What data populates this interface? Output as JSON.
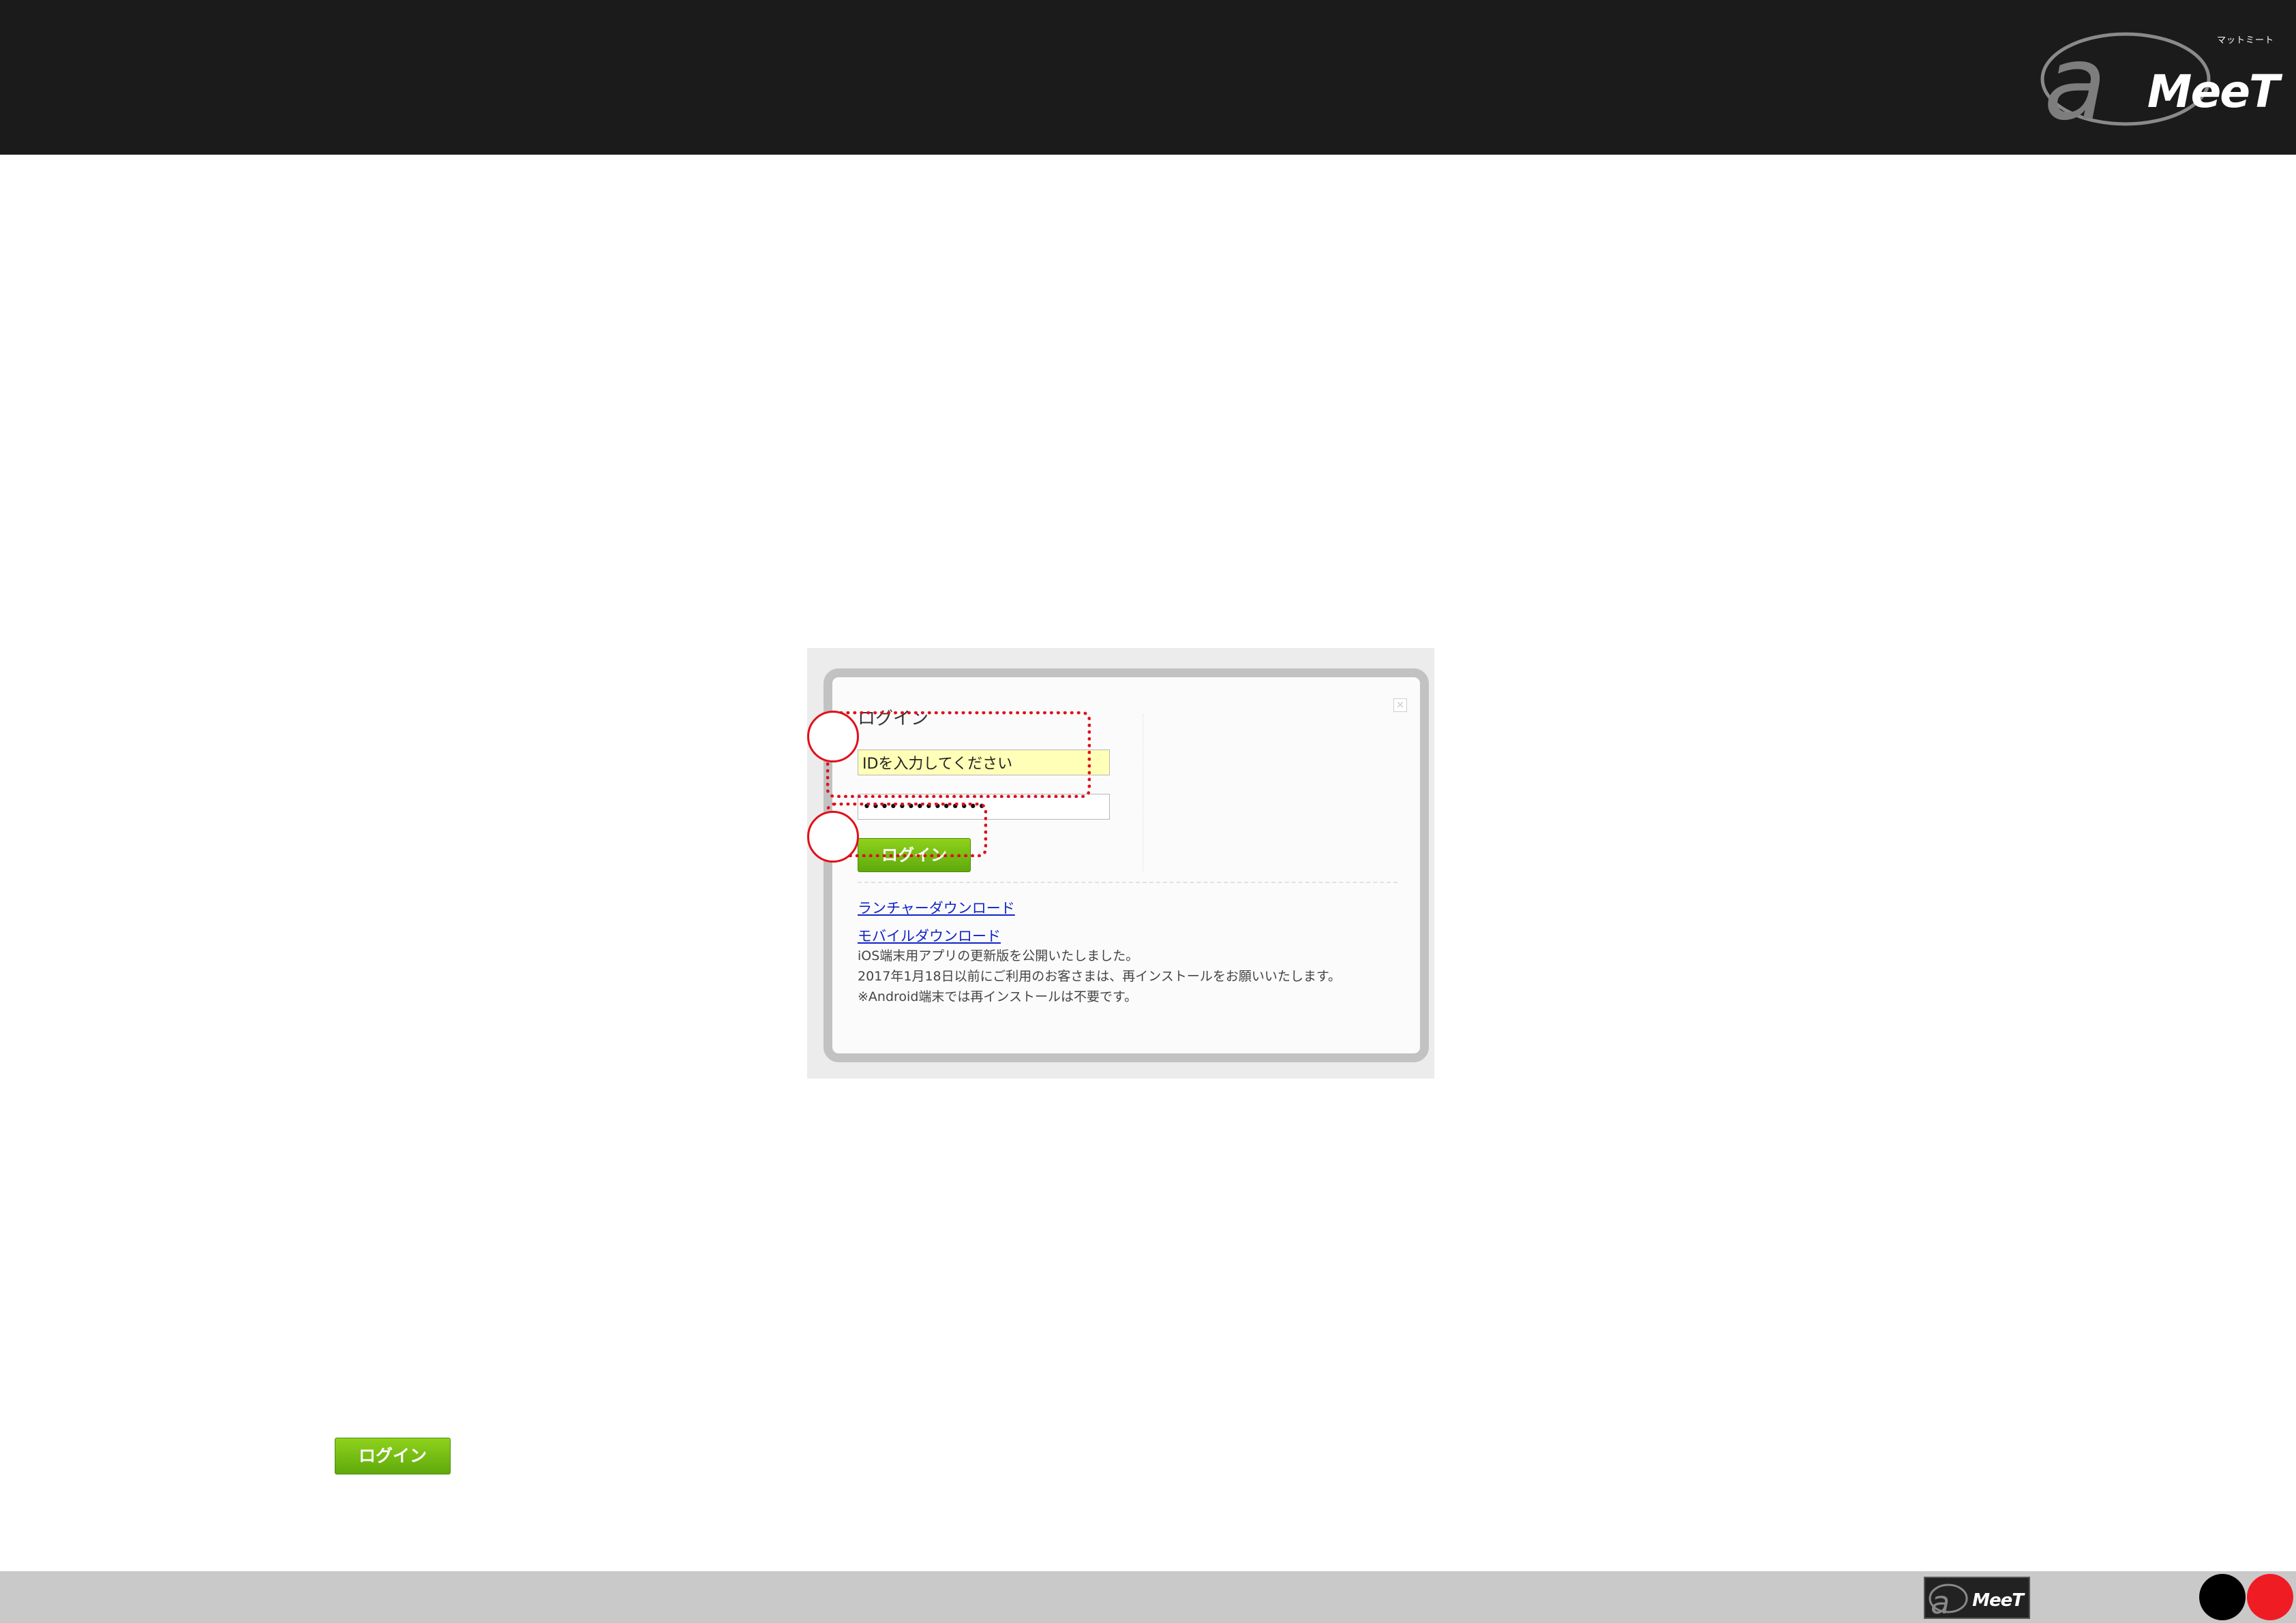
{
  "header": {
    "brand_small": "マットミート",
    "brand_word": "MeeT"
  },
  "login": {
    "title": "ログイン",
    "id_placeholder": "IDを入力してください",
    "password_value": "••••••••••••••",
    "login_button": "ログイン",
    "close_symbol": "×",
    "launcher_download": "ランチャーダウンロード",
    "mobile_download": "モバイルダウンロード",
    "notes": [
      "iOS端末用アプリの更新版を公開いたしました。",
      "2017年1月18日以前にご利用のお客さまは、再インストールをお願いいたします。",
      "※Android端末では再インストールは不要です。"
    ]
  },
  "sample_button": {
    "label": "ログイン"
  },
  "footer": {
    "logo_word": "MeeT"
  },
  "colors": {
    "header_bg": "#1b1b1b",
    "highlight": "#e0101a",
    "button_green": "#6cb614",
    "link": "#1024c8",
    "footer_bg": "#c9c9c9"
  }
}
